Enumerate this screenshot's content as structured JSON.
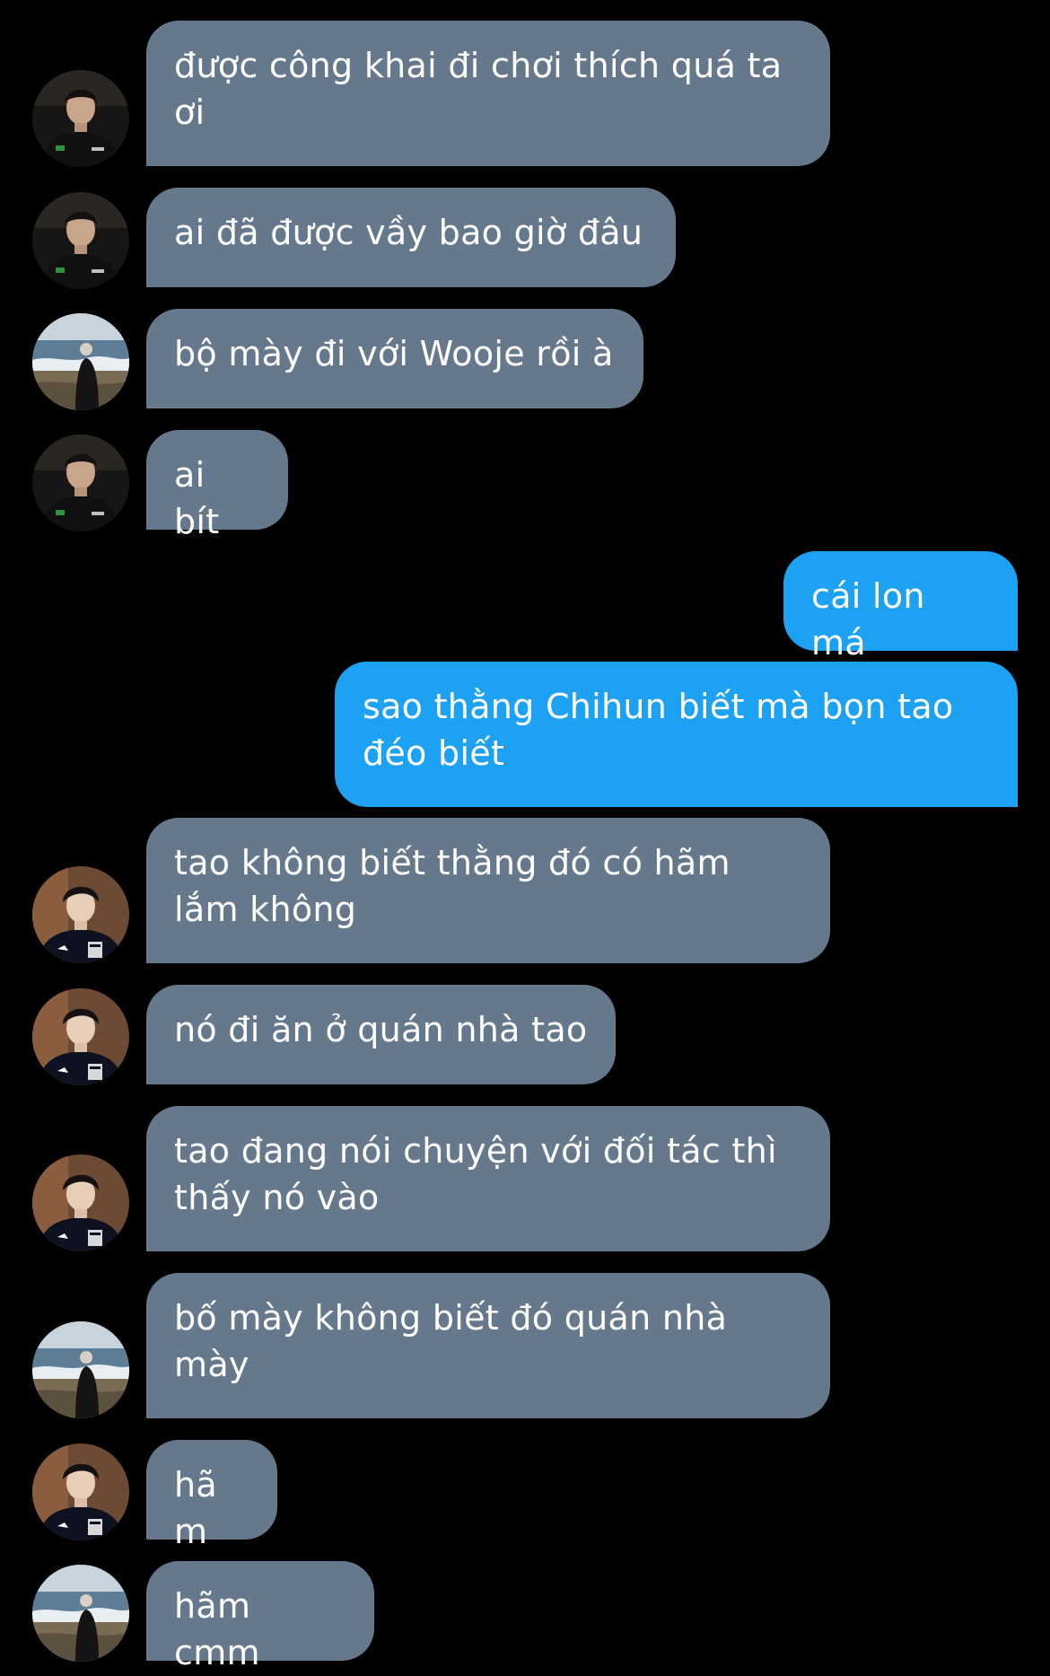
{
  "conversation": {
    "messages": [
      {
        "text": "được công khai đi chơi thích quá ta ơi",
        "direction": "incoming",
        "avatar": "dark-jersey-avatar"
      },
      {
        "text": "ai đã được vầy bao giờ đâu",
        "direction": "incoming",
        "avatar": "dark-jersey-avatar"
      },
      {
        "text": "bộ mày đi với Wooje rồi à",
        "direction": "incoming",
        "avatar": "beach-avatar"
      },
      {
        "text": "ai bít",
        "direction": "incoming",
        "avatar": "dark-jersey-avatar"
      },
      {
        "text": "cái lon má",
        "direction": "outgoing"
      },
      {
        "text": "sao thằng Chihun biết mà bọn tao đéo biết",
        "direction": "outgoing"
      },
      {
        "text": "tao không biết thằng đó có hãm lắm không",
        "direction": "incoming",
        "avatar": "puma-shirt-avatar"
      },
      {
        "text": "nó đi ăn ở quán nhà tao",
        "direction": "incoming",
        "avatar": "puma-shirt-avatar"
      },
      {
        "text": "tao đang nói chuyện với đối tác thì thấy nó vào",
        "direction": "incoming",
        "avatar": "puma-shirt-avatar"
      },
      {
        "text": "bố mày không biết đó quán nhà mày",
        "direction": "incoming",
        "avatar": "beach-avatar"
      },
      {
        "text": "hãm",
        "direction": "incoming",
        "avatar": "puma-shirt-avatar"
      },
      {
        "text": "hãm cmm",
        "direction": "incoming",
        "avatar": "beach-avatar"
      }
    ]
  },
  "colors": {
    "background": "#000000",
    "incoming_bubble": "#66798c",
    "outgoing_bubble": "#1da1f2",
    "text": "#ffffff"
  }
}
